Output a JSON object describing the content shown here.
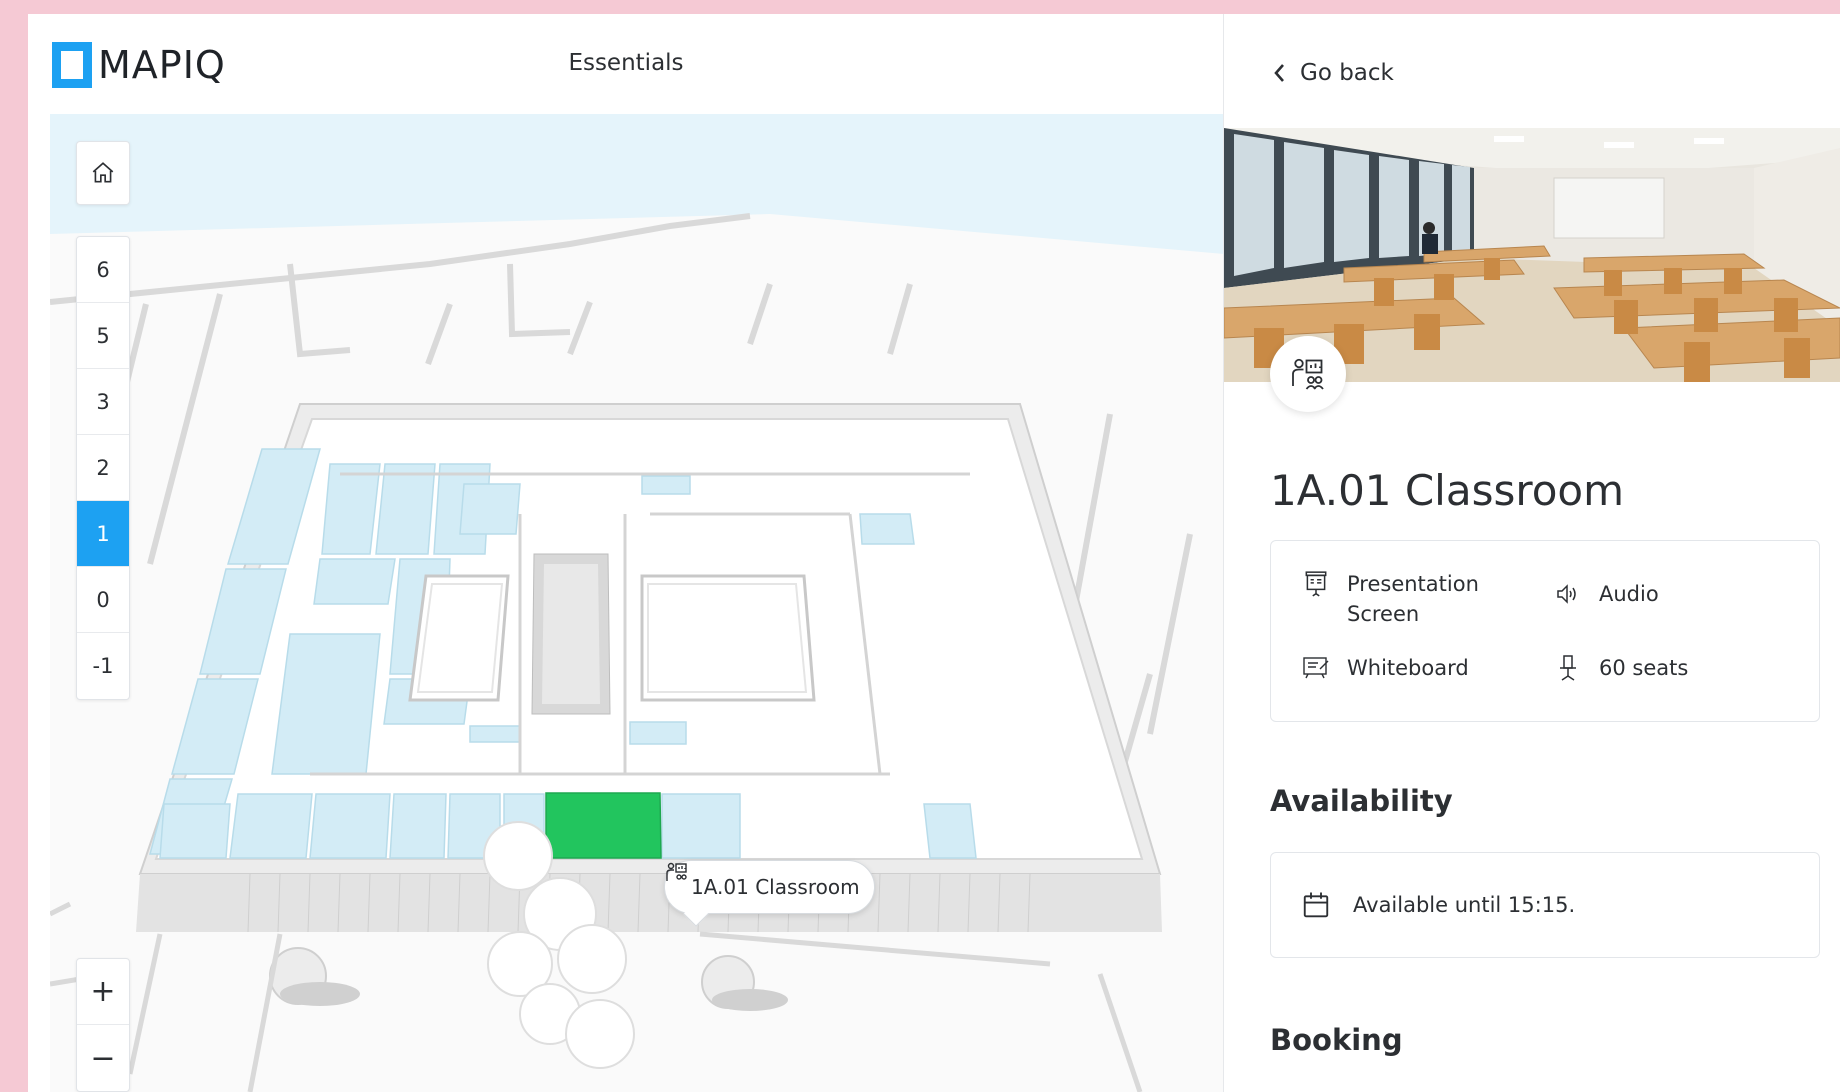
{
  "header": {
    "logo_text": "MAPIQ",
    "title": "Essentials"
  },
  "map": {
    "home_icon": "home-icon",
    "floors": [
      {
        "label": "6",
        "active": false
      },
      {
        "label": "5",
        "active": false
      },
      {
        "label": "3",
        "active": false
      },
      {
        "label": "2",
        "active": false
      },
      {
        "label": "1",
        "active": true
      },
      {
        "label": "0",
        "active": false
      },
      {
        "label": "-1",
        "active": false
      }
    ],
    "zoom_in_label": "+",
    "zoom_out_label": "−",
    "tooltip": {
      "icon": "classroom-icon",
      "label": "1A.01 Classroom"
    },
    "colors": {
      "room": "#d3ecf6",
      "selected_room": "#22c55e",
      "accent": "#1da1f2"
    }
  },
  "detail": {
    "back_label": "Go back",
    "room_title": "1A.01 Classroom",
    "features": [
      {
        "icon": "presentation-screen-icon",
        "label": "Presentation Screen"
      },
      {
        "icon": "audio-icon",
        "label": "Audio"
      },
      {
        "icon": "whiteboard-icon",
        "label": "Whiteboard"
      },
      {
        "icon": "seat-icon",
        "label": "60 seats"
      }
    ],
    "availability_heading": "Availability",
    "availability_text": "Available until 15:15.",
    "booking_heading": "Booking"
  }
}
